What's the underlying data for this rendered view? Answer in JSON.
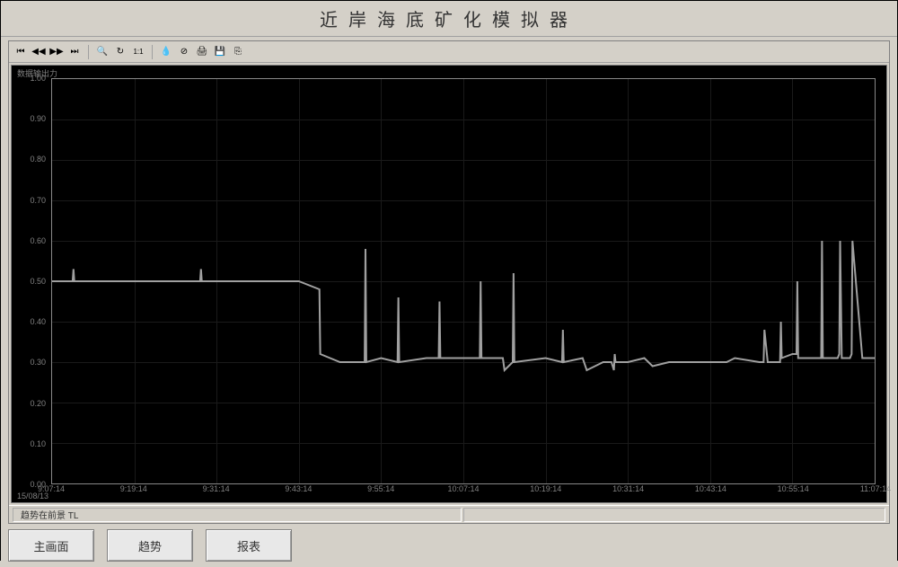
{
  "title": "近岸海底矿化模拟器",
  "toolbar": {
    "first": "⏮",
    "prev": "◀◀",
    "next": "▶▶",
    "last": "⏭",
    "search": "🔍",
    "refresh": "↻",
    "one_one": "1:1",
    "drop": "💧",
    "stop": "⊘",
    "print": "🖨",
    "save": "💾",
    "export": "⎘"
  },
  "chart": {
    "header_label": "数据输出力"
  },
  "status": {
    "foreground": "趋势在前景 TL"
  },
  "buttons": {
    "main": "主画面",
    "trend": "趋势",
    "report": "报表"
  },
  "chart_data": {
    "type": "line",
    "title": "数据输出力",
    "xlabel": "",
    "ylabel": "",
    "ylim": [
      0.0,
      1.0
    ],
    "y_ticks": [
      0.0,
      0.1,
      0.2,
      0.3,
      0.4,
      0.5,
      0.6,
      0.7,
      0.8,
      0.9,
      1.0
    ],
    "x_date": "15/08/13",
    "x_ticks": [
      "9:07:14",
      "9:19:14",
      "9:31:14",
      "9:43:14",
      "9:55:14",
      "10:07:14",
      "10:19:14",
      "10:31:14",
      "10:43:14",
      "10:55:14",
      "11:07:14"
    ],
    "series": [
      {
        "name": "TL",
        "color": "#a0a0a0",
        "x": [
          0.0,
          0.025,
          0.026,
          0.027,
          0.1,
          0.18,
          0.181,
          0.182,
          0.3,
          0.325,
          0.326,
          0.35,
          0.38,
          0.381,
          0.382,
          0.4,
          0.42,
          0.421,
          0.422,
          0.455,
          0.47,
          0.471,
          0.472,
          0.5,
          0.52,
          0.521,
          0.522,
          0.548,
          0.55,
          0.56,
          0.561,
          0.562,
          0.6,
          0.62,
          0.621,
          0.622,
          0.645,
          0.65,
          0.67,
          0.68,
          0.683,
          0.684,
          0.685,
          0.7,
          0.72,
          0.73,
          0.75,
          0.76,
          0.8,
          0.82,
          0.83,
          0.86,
          0.865,
          0.866,
          0.87,
          0.885,
          0.886,
          0.887,
          0.9,
          0.905,
          0.906,
          0.907,
          0.93,
          0.935,
          0.936,
          0.937,
          0.945,
          0.955,
          0.957,
          0.958,
          0.96,
          0.97,
          0.972,
          0.973,
          0.985,
          1.0
        ],
        "y": [
          0.5,
          0.5,
          0.53,
          0.5,
          0.5,
          0.5,
          0.53,
          0.5,
          0.5,
          0.48,
          0.32,
          0.3,
          0.3,
          0.58,
          0.3,
          0.31,
          0.3,
          0.46,
          0.3,
          0.31,
          0.31,
          0.45,
          0.31,
          0.31,
          0.31,
          0.5,
          0.31,
          0.31,
          0.28,
          0.3,
          0.52,
          0.3,
          0.31,
          0.3,
          0.38,
          0.3,
          0.31,
          0.28,
          0.3,
          0.3,
          0.28,
          0.32,
          0.3,
          0.3,
          0.31,
          0.29,
          0.3,
          0.3,
          0.3,
          0.3,
          0.31,
          0.3,
          0.3,
          0.38,
          0.3,
          0.3,
          0.4,
          0.31,
          0.32,
          0.32,
          0.5,
          0.31,
          0.31,
          0.31,
          0.6,
          0.31,
          0.31,
          0.31,
          0.32,
          0.6,
          0.31,
          0.31,
          0.32,
          0.6,
          0.31,
          0.31
        ]
      }
    ]
  }
}
